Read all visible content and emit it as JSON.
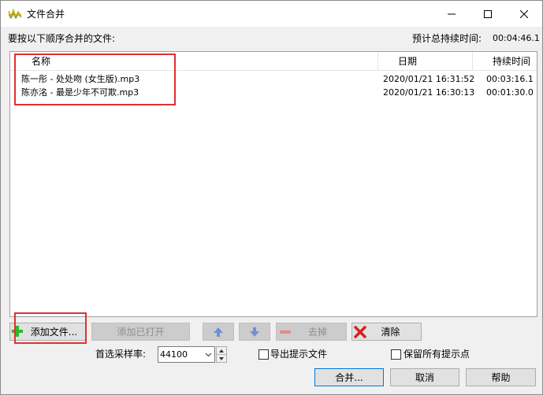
{
  "window": {
    "title": "文件合并",
    "icon": "audio-waveform-icon"
  },
  "header": {
    "instruction": "要按以下顺序合并的文件:",
    "total_duration_label": "预计总持续时间:",
    "total_duration_value": "00:04:46.1"
  },
  "file_list": {
    "columns": [
      "名称",
      "日期",
      "持续时间"
    ],
    "rows": [
      {
        "name": "陈一彤 - 处处吻 (女生版).mp3",
        "date": "2020/01/21 16:31:52",
        "duration": "00:03:16.1"
      },
      {
        "name": "陈亦洺 - 最是少年不可欺.mp3",
        "date": "2020/01/21 16:30:13",
        "duration": "00:01:30.0"
      }
    ]
  },
  "toolbar": {
    "add_files_label": "添加文件...",
    "add_opened_label": "添加已打开",
    "move_up_icon": "arrow-up-icon",
    "move_down_icon": "arrow-down-icon",
    "remove_label": "去掉",
    "clear_label": "清除"
  },
  "options": {
    "sample_rate_label": "首选采样率:",
    "sample_rate_value": "44100",
    "export_cues_label": "导出提示文件",
    "export_cues_checked": false,
    "keep_cues_label": "保留所有提示点",
    "keep_cues_checked": false
  },
  "footer": {
    "merge_label": "合并...",
    "cancel_label": "取消",
    "help_label": "帮助"
  },
  "colors": {
    "highlight": "#e03030",
    "add_icon": "#2eb82e",
    "arrow_icon": "#6f8fd8",
    "remove_icon": "#e88888",
    "clear_icon": "#d82020",
    "default_button_border": "#0078d7"
  }
}
